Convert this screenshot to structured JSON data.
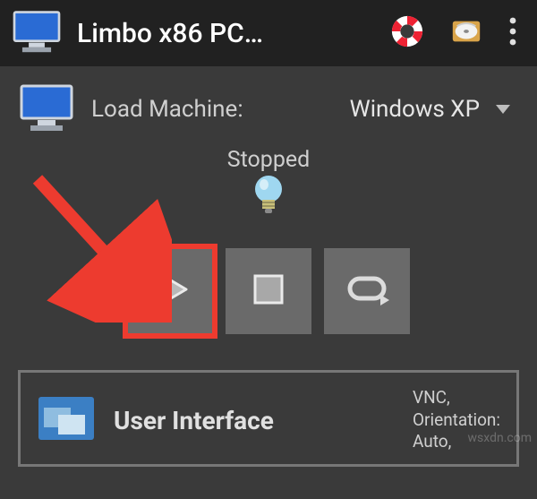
{
  "topbar": {
    "title": "Limbo x86 PC…"
  },
  "load": {
    "label": "Load Machine:",
    "selected": "Windows XP"
  },
  "status": {
    "text": "Stopped"
  },
  "section_ui": {
    "title": "User Interface",
    "meta_line1": "VNC,",
    "meta_line2": "Orientation:",
    "meta_line3": "Auto,"
  },
  "watermark": "wsxdn.com",
  "colors": {
    "highlight": "#ed3b2f",
    "bg": "#3a3a3a",
    "bar": "#212121"
  }
}
